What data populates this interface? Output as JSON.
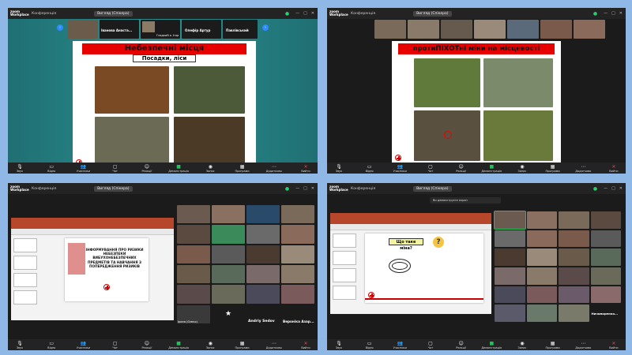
{
  "app": {
    "logo_line1": "zoom",
    "logo_line2": "Workplace",
    "conference_label": "Конференція",
    "view_button": "Вигляд (Спікера)",
    "view_button_short": "Вигляд"
  },
  "toolbar": {
    "items": [
      {
        "label": "Звук",
        "icon": "mic-icon"
      },
      {
        "label": "Відео",
        "icon": "video-icon"
      },
      {
        "label": "Учасники",
        "icon": "participants-icon"
      },
      {
        "label": "Чат",
        "icon": "chat-icon"
      },
      {
        "label": "Реакції",
        "icon": "reaction-icon"
      },
      {
        "label": "Демонстрація",
        "icon": "share-icon"
      },
      {
        "label": "Запис",
        "icon": "record-icon"
      },
      {
        "label": "Програми",
        "icon": "apps-icon"
      },
      {
        "label": "Додатково",
        "icon": "more-icon"
      },
      {
        "label": "Вийти",
        "icon": "leave-icon"
      }
    ]
  },
  "q1": {
    "participants": [
      "Іванова Анаста...",
      "Гладкий к. Ігор",
      "Олефір Артур",
      "Павлівський"
    ],
    "slide_title": "Небезпечні місця",
    "slide_subtitle": "Посадки, ліси"
  },
  "q2": {
    "slide_title": "протиПІХОТні міни на місцевості"
  },
  "q3": {
    "slide_text": "ІНФОРМУВАННЯ ПРО РИЗИКИ НЕБЕЗПЕКИ ВИБУХОНЕБЕЗПЕЧНИХ ПРЕДМЕТІВ ТА НАВЧАННЯ З ПОПЕРЕДЖЕННЯ РИЗИКІВ",
    "tile_names": [
      "Andriy Sedov",
      "Вероніка Азар..."
    ],
    "speaker_label": "Ірина (Олекс)"
  },
  "q4": {
    "slide_heading": "Що таке міна?",
    "share_banner": "Ви демонструєте екран",
    "tile_names": [
      "Ничипоренко..."
    ]
  },
  "colors": {
    "zoom_bar": "#232323",
    "zoom_blue": "#2d8cff",
    "slide_red": "#e60000",
    "ppt_orange": "#b7472a",
    "shield_green": "#2ecc71"
  }
}
